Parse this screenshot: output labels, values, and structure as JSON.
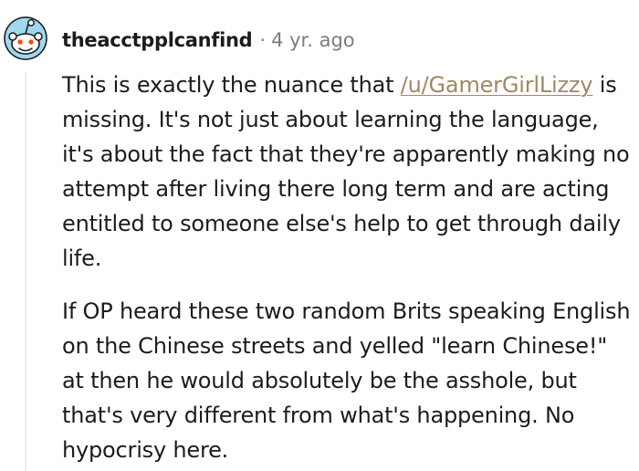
{
  "comment": {
    "username": "theacctpplcanfind",
    "separator": "·",
    "timestamp": "4 yr. ago",
    "avatar_icon": "reddit-snoo-icon",
    "colors": {
      "mention_link": "#a08866",
      "meta_gray": "#7c7c7c",
      "avatar_blue": "#0dd3bb"
    },
    "paragraph1": {
      "before_mention": "This is exactly the nuance that ",
      "mention": "/u/GamerGirlLizzy",
      "after_mention": " is missing. It's not just about learning the language, it's about the fact that they're apparently making no attempt after living there long term and are acting entitled to someone else's help to get through daily life."
    },
    "paragraph2": "If OP heard these two random Brits speaking English on the Chinese streets and yelled \"learn Chinese!\" at then he would absolutely be the asshole, but that's very different from what's happening. No hypocrisy here."
  }
}
